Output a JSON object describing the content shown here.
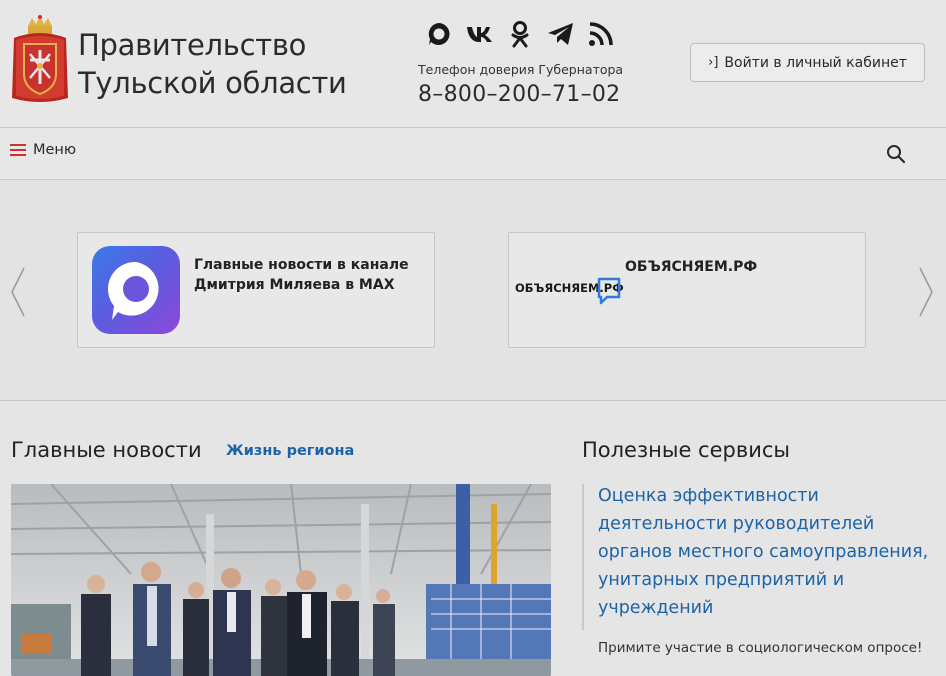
{
  "header": {
    "title_line1": "Правительство",
    "title_line2": "Тульской области",
    "hotline_label": "Телефон доверия Губернатора",
    "hotline_number": "8–800–200–71–02",
    "login_label": "Войти в личный кабинет",
    "socials": [
      "max-icon",
      "vk-icon",
      "odnoklassniki-icon",
      "telegram-icon",
      "rss-icon"
    ]
  },
  "nav": {
    "menu_label": "Меню"
  },
  "carousel": {
    "cards": [
      {
        "text": "Главные новости в канале Дмитрия Миляева в MAX"
      },
      {
        "logo_text": "ОБЪЯСНЯЕМ.РФ",
        "text": "ОБЪЯСНЯЕМ.РФ"
      }
    ]
  },
  "news": {
    "heading": "Главные новости",
    "link": "Жизнь региона"
  },
  "services": {
    "heading": "Полезные сервисы",
    "link": "Оценка эффективности деятельности руководителей органов местного самоуправления, унитарных предприятий и учреждений",
    "note": "Примите участие в социологическом опросе!"
  },
  "colors": {
    "link": "#1d63a8",
    "menu_icon": "#c8322f",
    "background": "#e5e5e5"
  }
}
